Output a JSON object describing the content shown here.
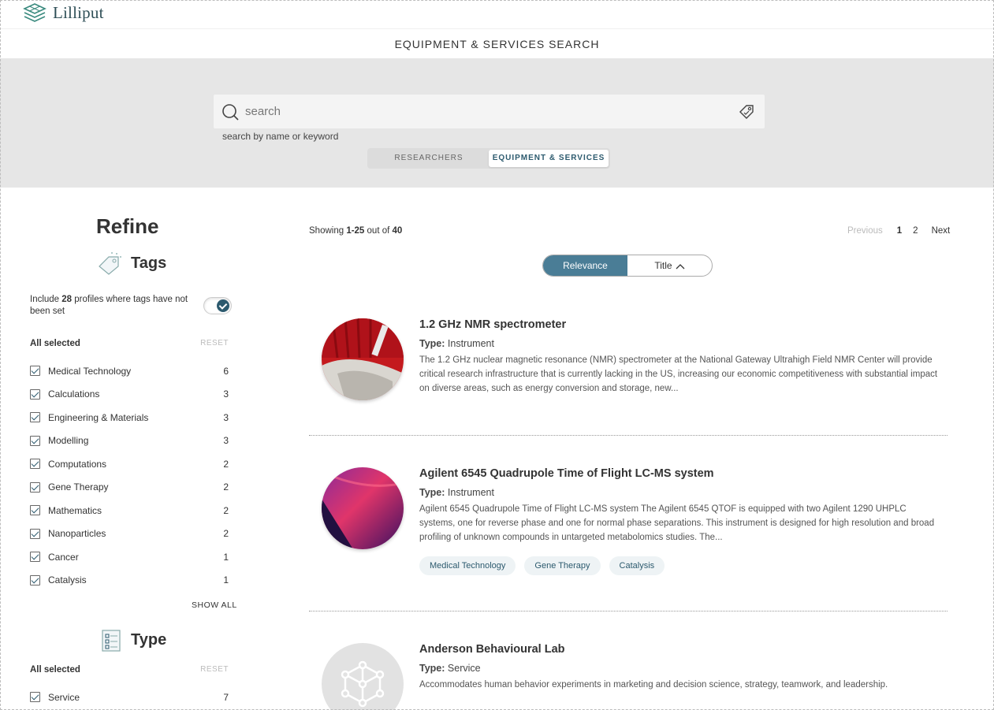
{
  "app": {
    "name": "Lilliput"
  },
  "page_title": "EQUIPMENT & SERVICES SEARCH",
  "search": {
    "placeholder": "search",
    "hint": "search by name or keyword",
    "tabs": [
      {
        "label": "RESEARCHERS",
        "active": false
      },
      {
        "label": "EQUIPMENT & SERVICES",
        "active": true
      }
    ]
  },
  "sidebar": {
    "title": "Refine",
    "tags": {
      "heading": "Tags",
      "include_prefix": "Include ",
      "include_count": "28",
      "include_suffix": " profiles where tags have not been set",
      "toggle_on": true,
      "all_selected": "All selected",
      "reset": "RESET",
      "items": [
        {
          "label": "Medical Technology",
          "count": "6"
        },
        {
          "label": "Calculations",
          "count": "3"
        },
        {
          "label": "Engineering & Materials",
          "count": "3"
        },
        {
          "label": "Modelling",
          "count": "3"
        },
        {
          "label": "Computations",
          "count": "2"
        },
        {
          "label": "Gene Therapy",
          "count": "2"
        },
        {
          "label": "Mathematics",
          "count": "2"
        },
        {
          "label": "Nanoparticles",
          "count": "2"
        },
        {
          "label": "Cancer",
          "count": "1"
        },
        {
          "label": "Catalysis",
          "count": "1"
        }
      ],
      "show_all": "SHOW ALL"
    },
    "type": {
      "heading": "Type",
      "all_selected": "All selected",
      "reset": "RESET",
      "items": [
        {
          "label": "Service",
          "count": "7"
        }
      ]
    }
  },
  "results": {
    "showing_prefix": "Showing ",
    "showing_range": "1-25",
    "showing_mid": " out of ",
    "showing_total": "40",
    "pager": {
      "previous": "Previous",
      "pages": [
        "1",
        "2"
      ],
      "current": "1",
      "next": "Next"
    },
    "sort": {
      "relevance": "Relevance",
      "title": "Title"
    },
    "type_label": "Type:",
    "items": [
      {
        "title": "1.2 GHz NMR spectrometer",
        "type": "Instrument",
        "description": "The 1.2 GHz nuclear magnetic resonance (NMR) spectrometer at the National Gateway Ultrahigh Field NMR Center will provide critical research infrastructure that is currently lacking in the US, increasing our economic competitiveness with substantial impact on diverse areas, such as energy conversion and storage, new...",
        "tags": []
      },
      {
        "title": "Agilent 6545 Quadrupole Time of Flight LC-MS system",
        "type": "Instrument",
        "description": "Agilent 6545 Quadrupole Time of Flight LC-MS system The Agilent 6545 QTOF is equipped with two Agilent 1290 UHPLC systems, one for reverse phase and one for normal phase separations. This instrument is designed for high resolution and broad profiling of unknown compounds in untargeted metabolomics studies. The...",
        "tags": [
          "Medical Technology",
          "Gene Therapy",
          "Catalysis"
        ]
      },
      {
        "title": "Anderson Behavioural Lab",
        "type": "Service",
        "description": "Accommodates human behavior experiments in marketing and decision science, strategy, teamwork, and leadership.",
        "tags": []
      }
    ]
  },
  "colors": {
    "accent": "#4a7d96",
    "brand": "#2c5a6e",
    "logo": "#3a8a7e"
  }
}
